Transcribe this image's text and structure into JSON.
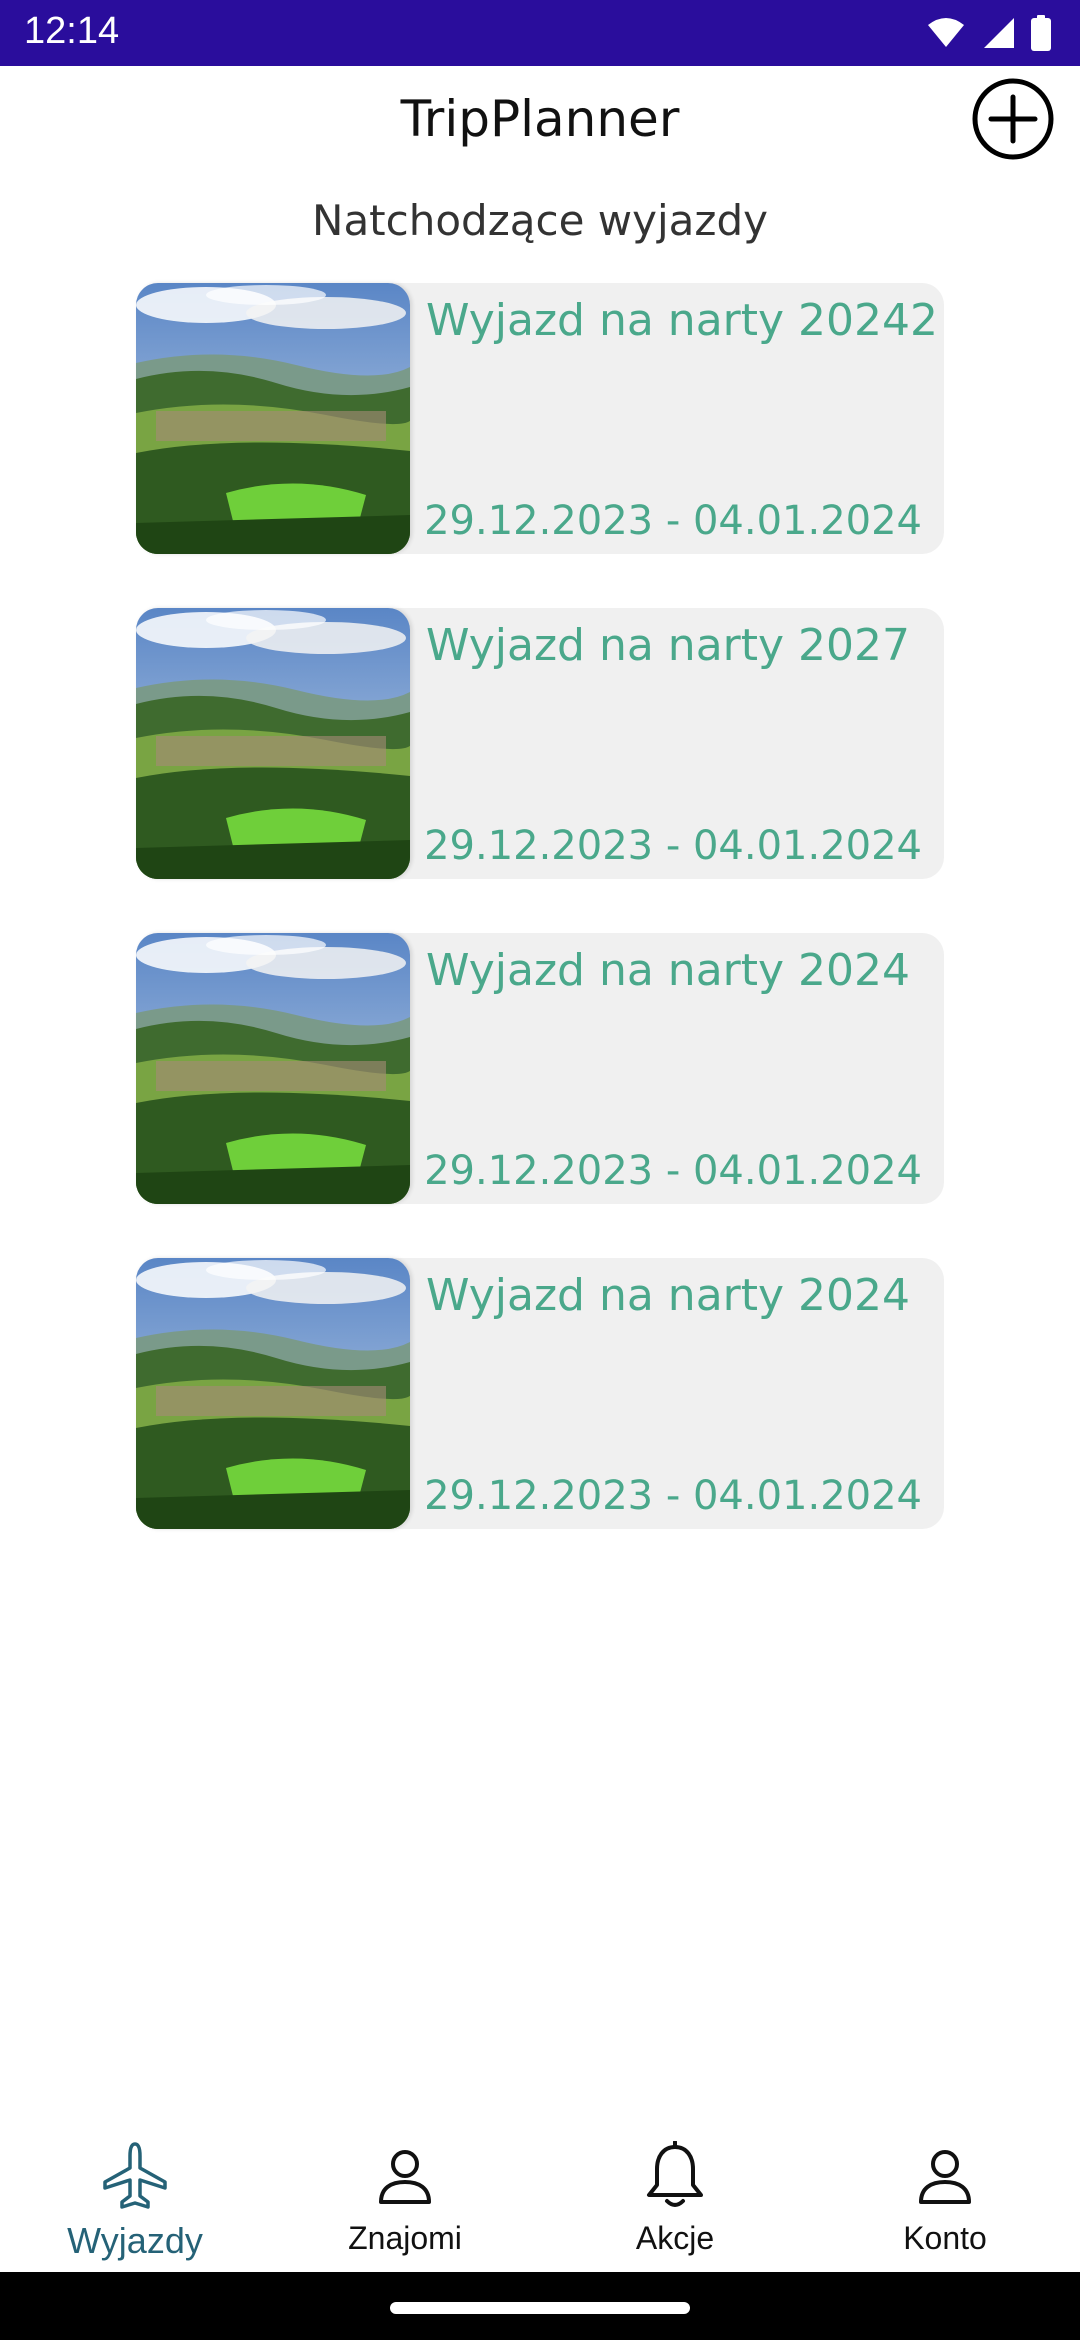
{
  "status_bar": {
    "time": "12:14",
    "icons": [
      "wifi-icon",
      "signal-icon",
      "battery-icon"
    ]
  },
  "header": {
    "title": "TripPlanner",
    "add_icon": "plus-circle-icon"
  },
  "section": {
    "title": "Natchodzące wyjazdy"
  },
  "trips": [
    {
      "name": "Wyjazd na narty 20242",
      "dates": "29.12.2023 - 04.01.2024"
    },
    {
      "name": "Wyjazd na narty 2027",
      "dates": "29.12.2023 - 04.01.2024"
    },
    {
      "name": "Wyjazd na narty 2024",
      "dates": "29.12.2023 - 04.01.2024"
    },
    {
      "name": "Wyjazd na narty 2024",
      "dates": "29.12.2023 - 04.01.2024"
    }
  ],
  "bottom_nav": {
    "items": [
      {
        "label": "Wyjazdy",
        "icon": "airplane-icon",
        "active": true
      },
      {
        "label": "Znajomi",
        "icon": "person-icon",
        "active": false
      },
      {
        "label": "Akcje",
        "icon": "bell-icon",
        "active": false
      },
      {
        "label": "Konto",
        "icon": "person-icon",
        "active": false
      }
    ]
  },
  "colors": {
    "status_bar": "#2a0d9c",
    "accent_text": "#4aa88b",
    "active_nav": "#256277",
    "card_bg": "#f0f0f0"
  }
}
